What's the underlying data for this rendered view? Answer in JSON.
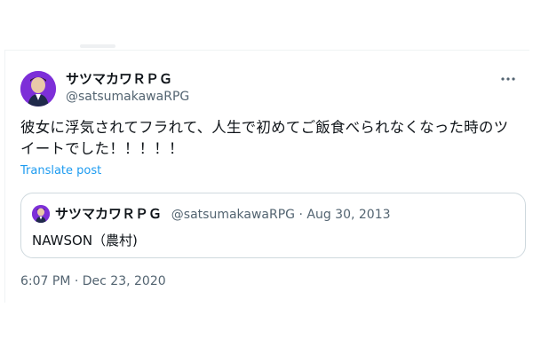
{
  "author": {
    "name": "サツマカワＲＰＧ",
    "handle": "@satsumakawaRPG"
  },
  "tweet": {
    "text": "彼女に浮気されてフラれて、人生で初めてご飯食べられなくなった時のツイートでした！！！！！",
    "translate_label": "Translate post",
    "timestamp": "6:07 PM · Dec 23, 2020"
  },
  "quoted": {
    "name": "サツマカワＲＰＧ",
    "meta": "@satsumakawaRPG · Aug 30, 2013",
    "text": "NAWSON（農村)"
  },
  "icons": [
    "more-icon"
  ],
  "colors": {
    "link": "#1d9bf0",
    "secondary_text": "#536471",
    "avatar_bg": "#7d2fd8",
    "border": "#cfd9de"
  }
}
